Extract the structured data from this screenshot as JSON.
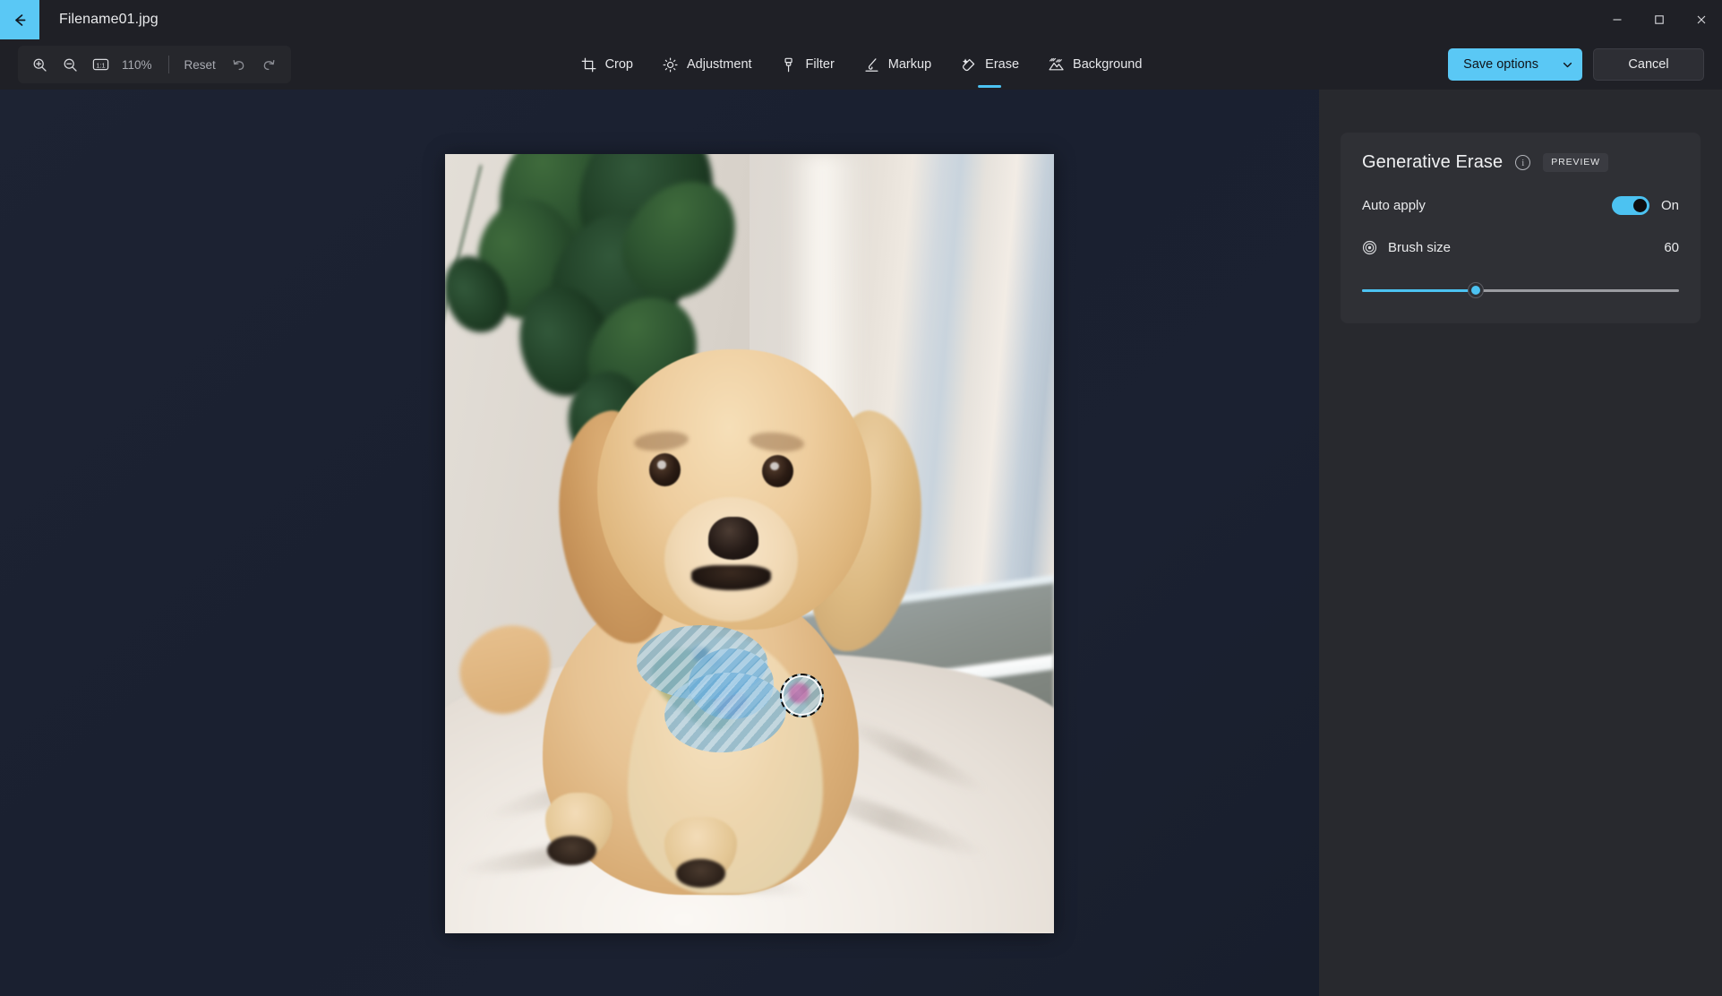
{
  "window": {
    "filename": "Filename01.jpg",
    "back_icon": "arrow-left-icon",
    "controls": {
      "minimize": "—",
      "maximize": "□",
      "close": "✕"
    }
  },
  "zoom_toolbar": {
    "zoom_in_icon": "zoom-in-icon",
    "zoom_out_icon": "zoom-out-icon",
    "actual_size_icon": "1:1",
    "zoom_level": "110%",
    "reset_label": "Reset",
    "undo_icon": "undo-icon",
    "redo_icon": "redo-icon"
  },
  "tools": [
    {
      "id": "crop",
      "label": "Crop",
      "icon": "crop-icon",
      "active": false
    },
    {
      "id": "adjustment",
      "label": "Adjustment",
      "icon": "brightness-icon",
      "active": false
    },
    {
      "id": "filter",
      "label": "Filter",
      "icon": "filter-icon",
      "active": false
    },
    {
      "id": "markup",
      "label": "Markup",
      "icon": "pen-icon",
      "active": false
    },
    {
      "id": "erase",
      "label": "Erase",
      "icon": "eraser-icon",
      "active": true
    },
    {
      "id": "background",
      "label": "Background",
      "icon": "background-icon",
      "active": false
    }
  ],
  "actions": {
    "save_options_label": "Save options",
    "save_options_chevron": "chevron-down-icon",
    "cancel_label": "Cancel"
  },
  "panel": {
    "title": "Generative Erase",
    "info_icon": "info-icon",
    "info_glyph": "i",
    "badge": "PREVIEW",
    "auto_apply": {
      "label": "Auto apply",
      "state": "On",
      "enabled": true
    },
    "brush_size": {
      "label": "Brush size",
      "icon": "brush-size-icon",
      "value": "60",
      "percent": 36
    }
  },
  "canvas": {
    "photo_alt": "Tan cockapoo dog sitting on a white cushion by a window with a blurred houseplant",
    "erase_selection": "striped-erase-mask",
    "brush_cursor": "dashed-circle-brush-cursor"
  },
  "colors": {
    "accent": "#4cc2f1",
    "accent_button": "#5ac8f5",
    "canvas_bg": "#1b2130",
    "chrome_bg": "#1f2026",
    "panel_bg": "#28292e",
    "card_bg": "#2f3035"
  }
}
